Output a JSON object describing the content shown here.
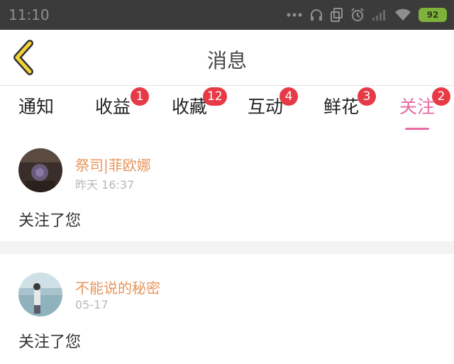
{
  "status_bar": {
    "time": "11:10",
    "battery_level": "92",
    "icons": [
      "more-dots-icon",
      "headphones-icon",
      "copy-icon",
      "alarm-icon",
      "signal-icon",
      "wifi-icon",
      "battery-icon"
    ]
  },
  "header": {
    "title": "消息",
    "back_icon": "chevron-left-icon"
  },
  "colors": {
    "accent_pink": "#e86aa0",
    "badge_red": "#e63a46",
    "sender_orange": "#e8955d",
    "back_icon_yellow": "#f2d33a"
  },
  "tabs": [
    {
      "label": "通知",
      "badge": null
    },
    {
      "label": "收益",
      "badge": "1"
    },
    {
      "label": "收藏",
      "badge": "12"
    },
    {
      "label": "互动",
      "badge": "4"
    },
    {
      "label": "鲜花",
      "badge": "3"
    },
    {
      "label": "关注",
      "badge": "2",
      "active": true
    }
  ],
  "messages": [
    {
      "sender": "祭司|菲欧娜",
      "time": "昨天 16:37",
      "text": "关注了您"
    },
    {
      "sender": "不能说的秘密",
      "time": "05-17",
      "text": "关注了您"
    }
  ]
}
